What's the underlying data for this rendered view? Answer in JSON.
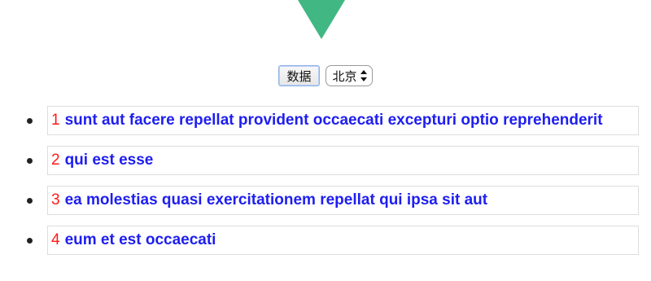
{
  "controls": {
    "data_button_label": "数据",
    "city_select_value": "北京"
  },
  "posts": [
    {
      "number": "1",
      "title": "sunt aut facere repellat provident occaecati excepturi optio reprehenderit"
    },
    {
      "number": "2",
      "title": "qui est esse"
    },
    {
      "number": "3",
      "title": "ea molestias quasi exercitationem repellat qui ipsa sit aut"
    },
    {
      "number": "4",
      "title": "eum et est occaecati"
    }
  ],
  "colors": {
    "logo_green": "#41b883",
    "number_red": "#ff1a1a",
    "title_blue": "#1e1ef0"
  }
}
